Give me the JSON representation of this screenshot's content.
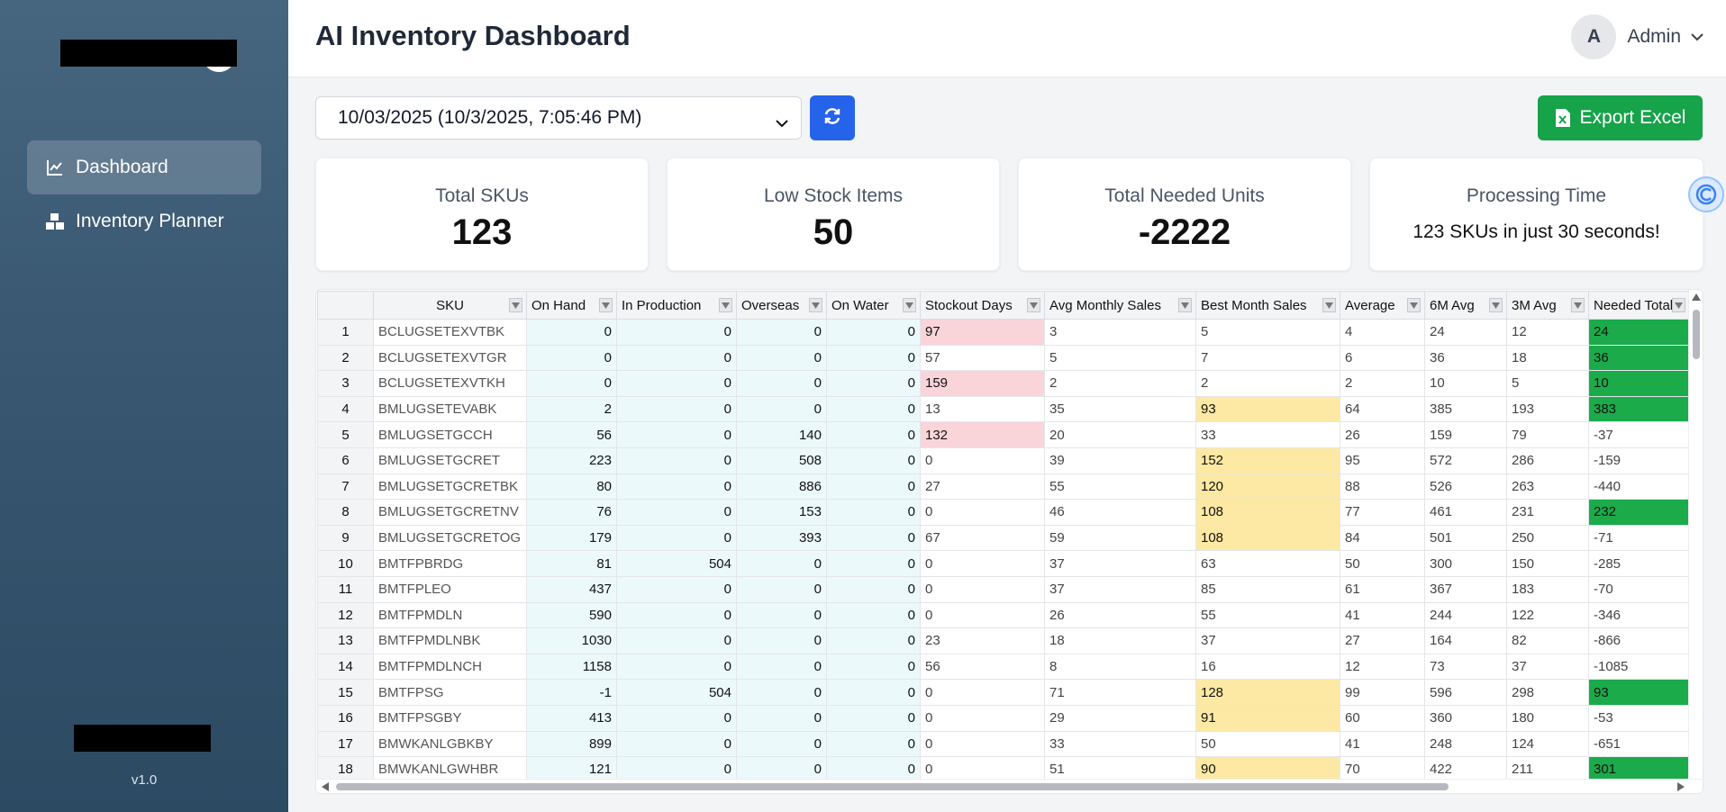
{
  "sidebar": {
    "items": [
      {
        "label": "Dashboard",
        "icon": "chart-line-icon",
        "active": true
      },
      {
        "label": "Inventory Planner",
        "icon": "boxes-icon",
        "active": false
      }
    ],
    "version": "v1.0"
  },
  "header": {
    "title": "AI Inventory Dashboard",
    "user": {
      "initial": "A",
      "name": "Admin"
    }
  },
  "controls": {
    "date_selected": "10/03/2025 (10/3/2025, 7:05:46 PM)",
    "export_label": "Export Excel"
  },
  "cards": [
    {
      "label": "Total SKUs",
      "value": "123"
    },
    {
      "label": "Low Stock Items",
      "value": "50"
    },
    {
      "label": "Total Needed Units",
      "value": "-2222"
    },
    {
      "label": "Processing Time",
      "value": "123 SKUs in just 30 seconds!"
    }
  ],
  "table": {
    "columns": [
      "",
      "SKU",
      "On Hand",
      "In Production",
      "Overseas",
      "On Water",
      "Stockout Days",
      "Avg Monthly Sales",
      "Best Month Sales",
      "Average",
      "6M Avg",
      "3M Avg",
      "Needed Total"
    ],
    "rows": [
      [
        "1",
        "BCLUGSETEXVTBK",
        "0",
        "0",
        "0",
        "0",
        "97",
        "3",
        "5",
        "4",
        "24",
        "12",
        "24"
      ],
      [
        "2",
        "BCLUGSETEXVTGR",
        "0",
        "0",
        "0",
        "0",
        "57",
        "5",
        "7",
        "6",
        "36",
        "18",
        "36"
      ],
      [
        "3",
        "BCLUGSETEXVTKH",
        "0",
        "0",
        "0",
        "0",
        "159",
        "2",
        "2",
        "2",
        "10",
        "5",
        "10"
      ],
      [
        "4",
        "BMLUGSETEVABK",
        "2",
        "0",
        "0",
        "0",
        "13",
        "35",
        "93",
        "64",
        "385",
        "193",
        "383"
      ],
      [
        "5",
        "BMLUGSETGCCH",
        "56",
        "0",
        "140",
        "0",
        "132",
        "20",
        "33",
        "26",
        "159",
        "79",
        "-37"
      ],
      [
        "6",
        "BMLUGSETGCRET",
        "223",
        "0",
        "508",
        "0",
        "0",
        "39",
        "152",
        "95",
        "572",
        "286",
        "-159"
      ],
      [
        "7",
        "BMLUGSETGCRETBK",
        "80",
        "0",
        "886",
        "0",
        "27",
        "55",
        "120",
        "88",
        "526",
        "263",
        "-440"
      ],
      [
        "8",
        "BMLUGSETGCRETNV",
        "76",
        "0",
        "153",
        "0",
        "0",
        "46",
        "108",
        "77",
        "461",
        "231",
        "232"
      ],
      [
        "9",
        "BMLUGSETGCRETOG",
        "179",
        "0",
        "393",
        "0",
        "67",
        "59",
        "108",
        "84",
        "501",
        "250",
        "-71"
      ],
      [
        "10",
        "BMTFPBRDG",
        "81",
        "504",
        "0",
        "0",
        "0",
        "37",
        "63",
        "50",
        "300",
        "150",
        "-285"
      ],
      [
        "11",
        "BMTFPLEO",
        "437",
        "0",
        "0",
        "0",
        "0",
        "37",
        "85",
        "61",
        "367",
        "183",
        "-70"
      ],
      [
        "12",
        "BMTFPMDLN",
        "590",
        "0",
        "0",
        "0",
        "0",
        "26",
        "55",
        "41",
        "244",
        "122",
        "-346"
      ],
      [
        "13",
        "BMTFPMDLNBK",
        "1030",
        "0",
        "0",
        "0",
        "23",
        "18",
        "37",
        "27",
        "164",
        "82",
        "-866"
      ],
      [
        "14",
        "BMTFPMDLNCH",
        "1158",
        "0",
        "0",
        "0",
        "56",
        "8",
        "16",
        "12",
        "73",
        "37",
        "-1085"
      ],
      [
        "15",
        "BMTFPSG",
        "-1",
        "504",
        "0",
        "0",
        "0",
        "71",
        "128",
        "99",
        "596",
        "298",
        "93"
      ],
      [
        "16",
        "BMTFPSGBY",
        "413",
        "0",
        "0",
        "0",
        "0",
        "29",
        "91",
        "60",
        "360",
        "180",
        "-53"
      ],
      [
        "17",
        "BMWKANLGBKBY",
        "899",
        "0",
        "0",
        "0",
        "0",
        "33",
        "50",
        "41",
        "248",
        "124",
        "-651"
      ],
      [
        "18",
        "BMWKANLGWHBR",
        "121",
        "0",
        "0",
        "0",
        "0",
        "51",
        "90",
        "70",
        "422",
        "211",
        "301"
      ]
    ],
    "highlights": {
      "stockout_red": [
        0,
        2,
        4
      ],
      "best_yellow": [
        3,
        5,
        6,
        7,
        8,
        14,
        15,
        17
      ],
      "needed_green": [
        0,
        1,
        2,
        3,
        7,
        14,
        17
      ]
    },
    "colors": {
      "red": "#f9d5da",
      "yellow": "#fde9a3",
      "green": "#1bab4b"
    }
  }
}
